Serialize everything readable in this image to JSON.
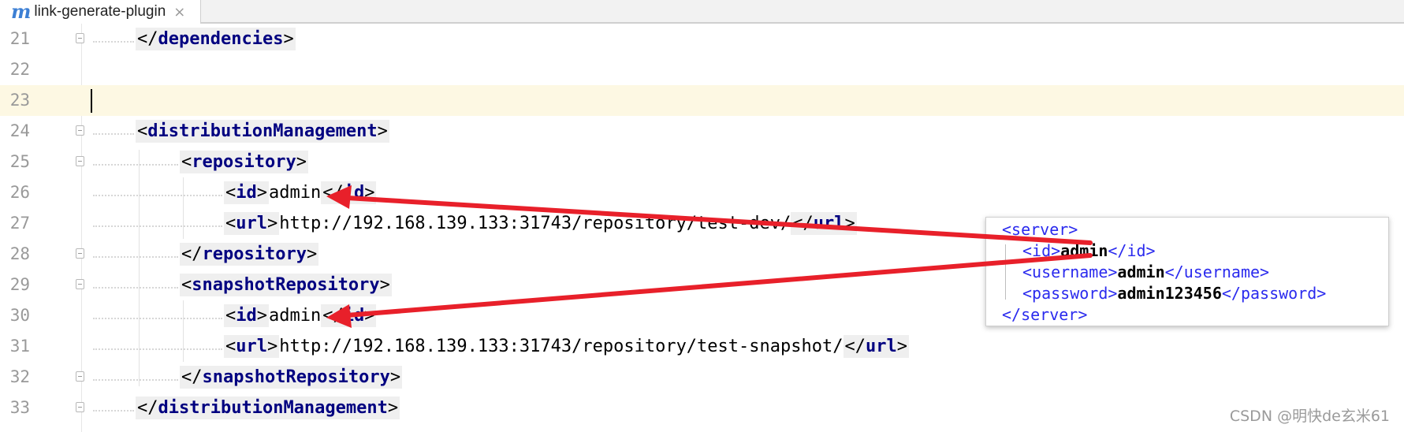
{
  "tab": {
    "icon": "maven-m-icon",
    "icon_glyph": "m",
    "title": "link-generate-plugin",
    "close": "×"
  },
  "editor": {
    "current_line": 23,
    "lines": [
      {
        "n": "21",
        "fold": true,
        "parts": {
          "open": "</",
          "name": "dependencies",
          "close": ">"
        }
      },
      {
        "n": "22"
      },
      {
        "n": "23"
      },
      {
        "n": "24",
        "fold": true,
        "parts": {
          "open": "<",
          "name": "distributionManagement",
          "close": ">"
        }
      },
      {
        "n": "25",
        "fold": true,
        "parts": {
          "open": "<",
          "name": "repository",
          "close": ">"
        }
      },
      {
        "n": "26",
        "parts": {
          "open": "<",
          "name": "id",
          "close": ">",
          "text": "admin",
          "open2": "</",
          "name2": "id",
          "close2": ">"
        }
      },
      {
        "n": "27",
        "parts": {
          "open": "<",
          "name": "url",
          "close": ">",
          "text": "http://192.168.139.133:31743/repository/test-dev/",
          "open2": "</",
          "name2": "url",
          "close2": ">"
        }
      },
      {
        "n": "28",
        "fold": true,
        "parts": {
          "open": "</",
          "name": "repository",
          "close": ">"
        }
      },
      {
        "n": "29",
        "fold": true,
        "parts": {
          "open": "<",
          "name": "snapshotRepository",
          "close": ">"
        }
      },
      {
        "n": "30",
        "parts": {
          "open": "<",
          "name": "id",
          "close": ">",
          "text": "admin",
          "open2": "</",
          "name2": "id",
          "close2": ">"
        }
      },
      {
        "n": "31",
        "parts": {
          "open": "<",
          "name": "url",
          "close": ">",
          "text": "http://192.168.139.133:31743/repository/test-snapshot/",
          "open2": "</",
          "name2": "url",
          "close2": ">"
        }
      },
      {
        "n": "32",
        "fold": true,
        "parts": {
          "open": "</",
          "name": "snapshotRepository",
          "close": ">"
        }
      },
      {
        "n": "33",
        "fold": true,
        "parts": {
          "open": "</",
          "name": "distributionManagement",
          "close": ">"
        }
      }
    ]
  },
  "popup": {
    "server_open": "<server>",
    "id_open": "<id>",
    "id_value": "admin",
    "id_close": "</id>",
    "username_open": "<username>",
    "username_value": "admin",
    "username_close": "</username>",
    "password_open": "<password>",
    "password_value": "admin123456",
    "password_close": "</password>",
    "server_close": "</server>"
  },
  "annotation": {
    "arrow_color": "#e8202a"
  },
  "watermark": "CSDN @明快de玄米61"
}
